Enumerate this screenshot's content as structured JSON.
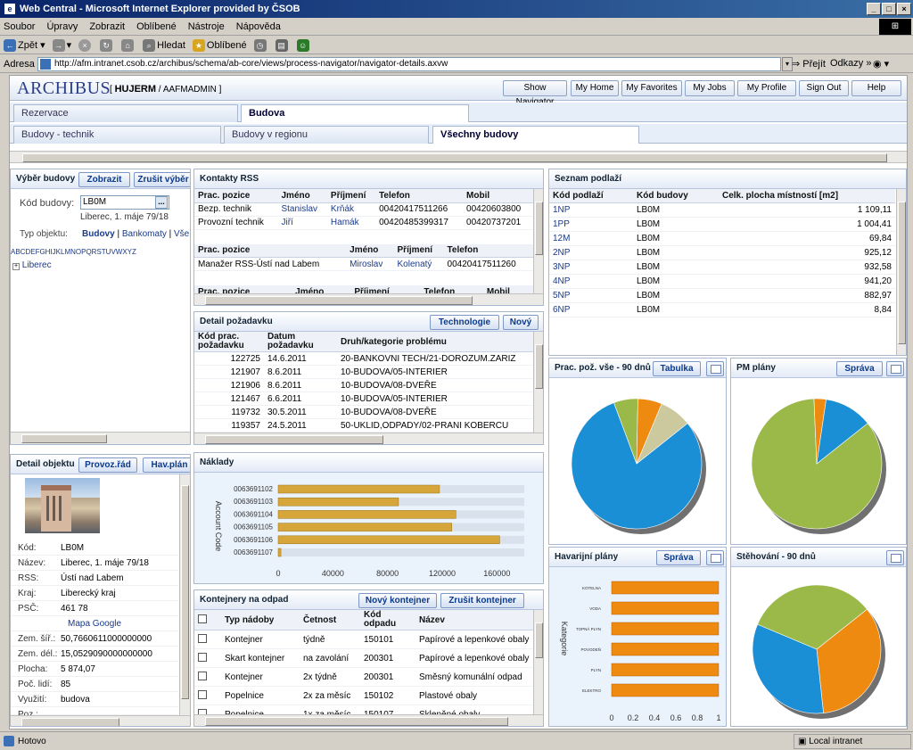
{
  "window": {
    "title": "Web Central - Microsoft Internet Explorer provided by ČSOB"
  },
  "menu": [
    "Soubor",
    "Úpravy",
    "Zobrazit",
    "Oblíbené",
    "Nástroje",
    "Nápověda"
  ],
  "toolbar": {
    "back": "Zpět",
    "search": "Hledat",
    "favorites": "Oblíbené"
  },
  "address": {
    "label": "Adresa",
    "url": "http://afm.intranet.csob.cz/archibus/schema/ab-core/views/process-navigator/navigator-details.axvw",
    "go": "Přejít",
    "links": "Odkazy"
  },
  "app": {
    "logo": "ARCHIBUS",
    "user": "HUJERM",
    "role": "AAFMADMIN",
    "nav": [
      "Show Navigator",
      "My Home",
      "My Favorites",
      "My Jobs",
      "My Profile",
      "Sign Out",
      "Help"
    ]
  },
  "tabs1": [
    "Rezervace",
    "Budova"
  ],
  "tabs2": [
    "Budovy - technik",
    "Budovy v regionu",
    "Všechny budovy"
  ],
  "vyber": {
    "title": "Výběr budovy",
    "btn_show": "Zobrazit",
    "btn_clear": "Zrušit výběr",
    "kod_label": "Kód budovy:",
    "kod_value": "LB0M",
    "address": "Liberec, 1. máje 79/18",
    "typ_label": "Typ objektu:",
    "typ_opts": [
      "Budovy",
      "Bankomaty",
      "Vše"
    ],
    "alphabet": "ABCDEFGHIJKLMNOPQRSTUVWXYZ",
    "tree_item": "Liberec"
  },
  "detail_obj": {
    "title": "Detail objektu",
    "btn1": "Provoz.řád",
    "btn2": "Hav.plán",
    "fields": [
      {
        "k": "Kód:",
        "v": "LB0M"
      },
      {
        "k": "Název:",
        "v": "Liberec, 1. máje 79/18"
      },
      {
        "k": "RSS:",
        "v": "Ústí nad Labem"
      },
      {
        "k": "Kraj:",
        "v": "Liberecký kraj"
      },
      {
        "k": "PSČ:",
        "v": "461 78"
      }
    ],
    "map_link": "Mapa Google",
    "fields2": [
      {
        "k": "Zem. šíř.:",
        "v": "50,7660611000000000"
      },
      {
        "k": "Zem. dél.:",
        "v": "15,0529090000000000"
      },
      {
        "k": "Plocha:",
        "v": "5 874,07"
      },
      {
        "k": "Poč. lidí:",
        "v": "85"
      },
      {
        "k": "Využití:",
        "v": "budova"
      },
      {
        "k": "Poz.:",
        "v": ""
      }
    ]
  },
  "kontakty": {
    "title": "Kontakty RSS",
    "h1": [
      "Prac. pozice",
      "Jméno",
      "Příjmení",
      "Telefon",
      "Mobil"
    ],
    "rows1": [
      [
        "Bezp. technik",
        "Stanislav",
        "Krňák",
        "00420417511266",
        "00420603800"
      ],
      [
        "Provozní technik",
        "Jiří",
        "Hamák",
        "00420485399317",
        "00420737201"
      ]
    ],
    "h2": [
      "Prac. pozice",
      "Jméno",
      "Příjmení",
      "Telefon"
    ],
    "rows2": [
      [
        "Manažer RSS-Ústí nad Labem",
        "Miroslav",
        "Kolenatý",
        "00420417511260"
      ]
    ],
    "h3": [
      "Prac. pozice",
      "Jméno",
      "Příjmení",
      "Telefon",
      "Mobil"
    ]
  },
  "pozadavek": {
    "title": "Detail požadavku",
    "btn1": "Technologie",
    "btn2": "Nový",
    "h": [
      "Kód prac. požadavku",
      "Datum požadavku",
      "Druh/kategorie problému"
    ],
    "rows": [
      [
        "122725",
        "14.6.2011",
        "20-BANKOVNI TECH/21-DOROZUM.ZARIZ"
      ],
      [
        "121907",
        "8.6.2011",
        "10-BUDOVA/05-INTERIER"
      ],
      [
        "121906",
        "8.6.2011",
        "10-BUDOVA/08-DVEŘE"
      ],
      [
        "121467",
        "6.6.2011",
        "10-BUDOVA/05-INTERIER"
      ],
      [
        "119732",
        "30.5.2011",
        "10-BUDOVA/08-DVEŘE"
      ],
      [
        "119357",
        "24.5.2011",
        "50-UKLID,ODPADY/02-PRANI KOBERCU"
      ]
    ]
  },
  "naklady": {
    "title": "Náklady",
    "ylabel": "Account Code"
  },
  "kontejnery": {
    "title": "Kontejnery na odpad",
    "btn1": "Nový kontejner",
    "btn2": "Zrušit kontejner",
    "h": [
      "Typ nádoby",
      "Četnost",
      "Kód odpadu",
      "Název"
    ],
    "rows": [
      [
        "Kontejner",
        "týdně",
        "150101",
        "Papírové a lepenkové obaly"
      ],
      [
        "Skart kontejner",
        "na zavolání",
        "200301",
        "Papírové a lepenkové obaly"
      ],
      [
        "Kontejner",
        "2x týdně",
        "200301",
        "Směsný komunální odpad"
      ],
      [
        "Popelnice",
        "2x za měsíc",
        "150102",
        "Plastové obaly"
      ],
      [
        "Popelnice",
        "1x za měsíc",
        "150107",
        "Skleněné obaly"
      ]
    ]
  },
  "podlazi": {
    "title": "Seznam podlaží",
    "h": [
      "Kód podlaží",
      "Kód budovy",
      "Celk. plocha místností [m2]"
    ],
    "rows": [
      [
        "1NP",
        "LB0M",
        "1 109,11"
      ],
      [
        "1PP",
        "LB0M",
        "1 004,41"
      ],
      [
        "12M",
        "LB0M",
        "69,84"
      ],
      [
        "2NP",
        "LB0M",
        "925,12"
      ],
      [
        "3NP",
        "LB0M",
        "932,58"
      ],
      [
        "4NP",
        "LB0M",
        "941,20"
      ],
      [
        "5NP",
        "LB0M",
        "882,97"
      ],
      [
        "6NP",
        "LB0M",
        "8,84"
      ]
    ]
  },
  "pie1": {
    "title": "Prac. pož. vše - 90 dnů",
    "btn": "Tabulka"
  },
  "pie2": {
    "title": "PM plány",
    "btn": "Správa"
  },
  "hav": {
    "title": "Havarijní plány",
    "btn": "Správa",
    "ylabel": "Kategorie"
  },
  "pie3": {
    "title": "Stěhování - 90 dnů"
  },
  "status": {
    "left": "Hotovo",
    "right": "Local intranet"
  },
  "chart_data": [
    {
      "type": "bar",
      "categories": [
        "0063691102",
        "0063691103",
        "0063691104",
        "0063691105",
        "0063691106",
        "0063691107"
      ],
      "values": [
        118000,
        88000,
        130000,
        127000,
        162000,
        2000
      ],
      "xlim": [
        0,
        180000
      ],
      "xticks": [
        0,
        40000,
        80000,
        120000,
        160000
      ],
      "ylabel": "Account Code",
      "orientation": "horizontal",
      "color": "#d6a63a"
    },
    {
      "type": "pie",
      "name": "Prac. pož. vše - 90 dnů",
      "values": [
        80,
        6,
        6,
        8
      ],
      "colors": [
        "#1a8fd6",
        "#9ab948",
        "#ee8a10",
        "#cdc99e"
      ]
    },
    {
      "type": "pie",
      "name": "PM plány",
      "values": [
        85,
        3,
        12
      ],
      "colors": [
        "#9ab948",
        "#ee8a10",
        "#1a8fd6"
      ]
    },
    {
      "type": "bar",
      "orientation": "horizontal",
      "categories": [
        "KOTELNA",
        "VODA",
        "TOPNÁ PLYN",
        "POVODEŇ",
        "PLYN",
        "ELEKTRO"
      ],
      "values": [
        1,
        1,
        1,
        1,
        1,
        1
      ],
      "xlim": [
        0,
        1
      ],
      "xticks": [
        0,
        0.2,
        0.4,
        0.6,
        0.8,
        1
      ],
      "ylabel": "Kategorie",
      "color": "#ee8a10"
    },
    {
      "type": "pie",
      "name": "Stěhování - 90 dnů",
      "values": [
        34,
        33,
        33
      ],
      "colors": [
        "#ee8a10",
        "#1a8fd6",
        "#9ab948"
      ]
    }
  ]
}
